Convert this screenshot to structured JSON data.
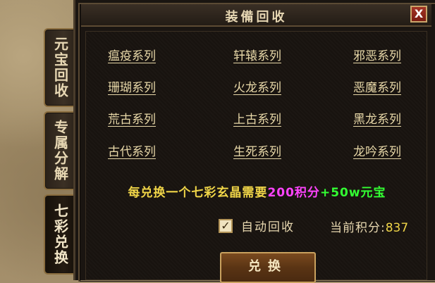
{
  "side_tabs": [
    {
      "label": "元宝回收"
    },
    {
      "label": "专属分解"
    },
    {
      "label": "七彩兑换"
    }
  ],
  "window": {
    "title": "装備回收",
    "close_label": "X"
  },
  "series": [
    [
      "瘟疫系列",
      "轩辕系列",
      "邪恶系列"
    ],
    [
      "珊瑚系列",
      "火龙系列",
      "恶魔系列"
    ],
    [
      "荒古系列",
      "上古系列",
      "黑龙系列"
    ],
    [
      "古代系列",
      "生死系列",
      "龙吟系列"
    ]
  ],
  "exchange_info": {
    "prefix": "每兑换一个七彩玄晶需要",
    "points_cost": "200积分",
    "plus": "+",
    "yuanbao_cost": "50w元宝"
  },
  "auto_recycle": {
    "label": "自动回收",
    "checked": true
  },
  "current_points": {
    "label": "当前积分:",
    "value": "837"
  },
  "exchange_button": {
    "label": "兑换"
  },
  "colors": {
    "highlight_yellow": "#f0d548",
    "highlight_magenta": "#ff44ff",
    "highlight_green": "#33ff33",
    "close_red": "#a33425"
  }
}
